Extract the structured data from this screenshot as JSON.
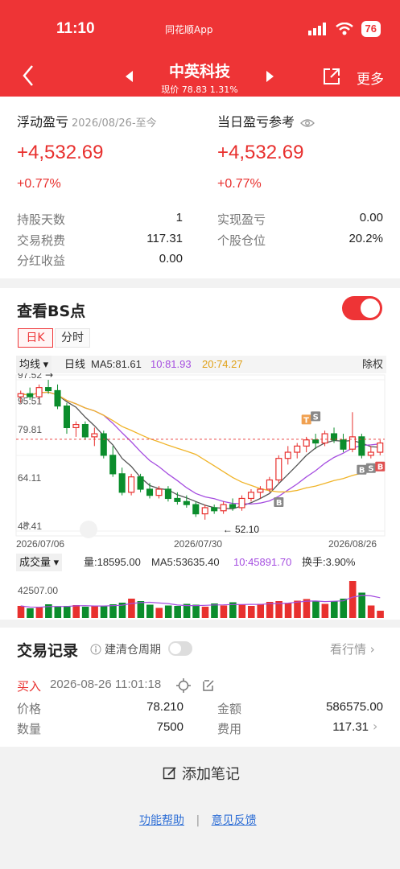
{
  "status": {
    "time": "11:10",
    "app_label": "同花顺App",
    "battery": "76"
  },
  "nav": {
    "title": "中英科技",
    "price_line": "现价 78.83 1.31%",
    "more": "更多"
  },
  "pnl": {
    "float_label": "浮动盈亏",
    "float_date": "2026/08/26-至今",
    "float_value": "+4,532.69",
    "float_pct": "+0.77%",
    "today_label": "当日盈亏参考",
    "today_value": "+4,532.69",
    "today_pct": "+0.77%",
    "rows": [
      {
        "k": "持股天数",
        "v": "1"
      },
      {
        "k": "交易税费",
        "v": "117.31"
      },
      {
        "k": "分红收益",
        "v": "0.00"
      }
    ],
    "rows_right": [
      {
        "k": "实现盈亏",
        "v": "0.00"
      },
      {
        "k": "个股仓位",
        "v": "20.2%"
      }
    ]
  },
  "bs": {
    "title": "查看BS点",
    "tabs": [
      "日K",
      "分时"
    ],
    "ma_select": "均线",
    "ma_type": "日线",
    "ma5": "MA5:81.61",
    "ma10": "10:81.93",
    "ma20": "20:74.27",
    "adjust": "除权",
    "y_labels": [
      "97.52",
      "95.51",
      "79.81",
      "64.11",
      "48.41"
    ],
    "low_label": "52.10",
    "dates": [
      "2026/07/06",
      "2026/07/30",
      "2026/08/26"
    ],
    "vol_select": "成交量",
    "vol_text": "量:18595.00",
    "vol_ma5": "MA5:53635.40",
    "vol_ma10": "10:45891.70",
    "turnover": "换手:3.90%",
    "vol_axis": "42507.00",
    "markers": [
      "T",
      "S",
      "B",
      "B",
      "S",
      "B"
    ]
  },
  "chart_data": {
    "type": "candlestick",
    "y_range": [
      48.41,
      97.52
    ],
    "candles": [
      [
        92,
        94,
        90,
        93
      ],
      [
        93,
        95,
        91,
        92
      ],
      [
        92,
        96,
        90,
        95
      ],
      [
        95,
        97.5,
        93,
        94
      ],
      [
        94,
        96,
        88,
        89
      ],
      [
        89,
        90,
        80,
        82
      ],
      [
        82,
        84,
        79,
        83
      ],
      [
        83,
        84,
        78,
        79
      ],
      [
        79,
        82,
        76,
        80
      ],
      [
        80,
        81,
        72,
        73
      ],
      [
        73,
        76,
        66,
        67
      ],
      [
        67,
        69,
        60,
        61
      ],
      [
        61,
        67,
        60,
        66
      ],
      [
        66,
        67,
        61,
        62
      ],
      [
        62,
        64,
        59,
        60
      ],
      [
        60,
        63,
        59,
        62
      ],
      [
        62,
        63,
        58,
        59
      ],
      [
        59,
        61,
        57,
        58
      ],
      [
        58,
        60,
        56,
        57
      ],
      [
        57,
        58,
        53,
        54
      ],
      [
        54,
        57,
        52.1,
        56
      ],
      [
        56,
        57,
        54,
        55
      ],
      [
        55,
        58,
        54,
        57
      ],
      [
        57,
        59,
        55,
        56
      ],
      [
        56,
        60,
        55,
        59
      ],
      [
        59,
        62,
        58,
        61
      ],
      [
        61,
        63,
        59,
        62
      ],
      [
        62,
        66,
        61,
        65
      ],
      [
        65,
        73,
        64,
        72
      ],
      [
        72,
        76,
        70,
        74
      ],
      [
        74,
        77,
        72,
        76
      ],
      [
        76,
        79,
        74,
        78
      ],
      [
        78,
        80,
        75,
        77
      ],
      [
        77,
        81,
        76,
        80
      ],
      [
        80,
        82,
        77,
        78
      ],
      [
        78,
        80,
        74,
        75
      ],
      [
        75,
        87,
        74,
        79
      ],
      [
        79,
        80,
        72,
        73
      ],
      [
        73,
        76,
        72,
        74
      ],
      [
        74,
        78,
        73,
        77
      ]
    ],
    "volume": [
      30,
      24,
      26,
      34,
      29,
      30,
      32,
      28,
      30,
      29,
      34,
      38,
      48,
      42,
      33,
      25,
      31,
      30,
      35,
      33,
      28,
      36,
      31,
      39,
      33,
      30,
      35,
      40,
      42,
      37,
      43,
      47,
      42,
      35,
      41,
      48,
      92,
      63,
      31,
      18
    ]
  },
  "trade": {
    "title": "交易记录",
    "hint": "建清仓周期",
    "market": "看行情",
    "buy": "买入",
    "time": "2026-08-26 11:01:18",
    "price_k": "价格",
    "price_v": "78.210",
    "amt_k": "金额",
    "amt_v": "586575.00",
    "qty_k": "数量",
    "qty_v": "7500",
    "fee_k": "费用",
    "fee_v": "117.31"
  },
  "footer": {
    "note": "添加笔记",
    "help": "功能帮助",
    "sep": "|",
    "feedback": "意见反馈"
  },
  "colors": {
    "up": "#e8302e",
    "down": "#0b8d2c",
    "ma5": "#555555",
    "ma10": "#a54de0",
    "ma20": "#f0b429"
  }
}
